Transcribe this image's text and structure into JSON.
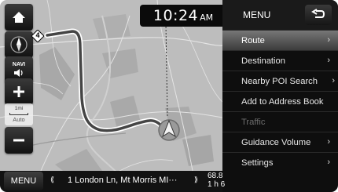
{
  "clock": {
    "time": "10:24",
    "ampm": "AM"
  },
  "left_controls": {
    "compass_marker": "4",
    "navi_label": "NAVI",
    "scale_value": "1mi",
    "scale_mode": "Auto"
  },
  "menu": {
    "title": "MENU",
    "items": [
      {
        "label": "Route",
        "chevron": "›",
        "selected": true
      },
      {
        "label": "Destination",
        "chevron": "›"
      },
      {
        "label": "Nearby POI Search",
        "chevron": "›"
      },
      {
        "label": "Add to Address Book",
        "chevron": ""
      },
      {
        "label": "Traffic",
        "chevron": "",
        "disabled": true
      },
      {
        "label": "Guidance Volume",
        "chevron": "›"
      },
      {
        "label": "Settings",
        "chevron": "›"
      }
    ]
  },
  "bottom_bar": {
    "menu_button": "MENU",
    "street": "1 London Ln, Mt Morris MI···",
    "distance_value": "68.8",
    "distance_time": "1 h 6"
  },
  "colors": {
    "route": "#454545",
    "map_bg": "#bfbfbf",
    "panel_bg": "#0e0e0e"
  }
}
